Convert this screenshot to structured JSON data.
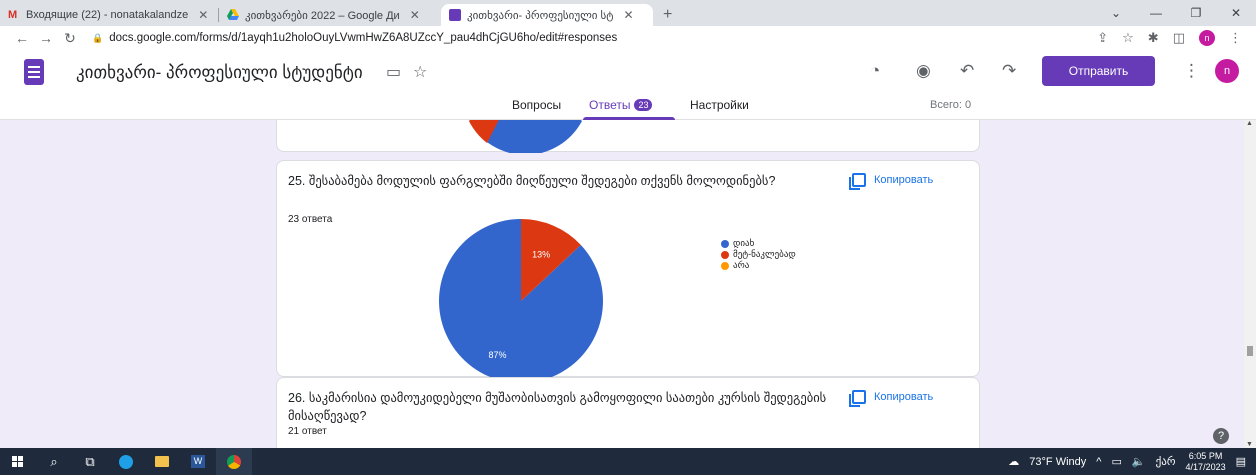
{
  "browser": {
    "tabs": [
      {
        "title": "Входящие (22) - nonatakalandze",
        "active": false
      },
      {
        "title": "კითხვარები 2022 – Google Ди",
        "active": false
      },
      {
        "title": "კითხვარი- პროფესიული სტ",
        "active": true
      }
    ],
    "url": "docs.google.com/forms/d/1ayqh1u2holoOuyLVwmHwZ6A8UZccY_pau4dhCjGU6ho/edit#responses",
    "profile_initial": "n"
  },
  "header": {
    "form_title": "კითხვარი- პროფესიული სტუდენტი",
    "send_label": "Отправить",
    "avatar_initial": "n",
    "tabs": {
      "questions": "Вопросы",
      "answers": "Ответы",
      "answers_count": "23",
      "settings": "Настройки"
    },
    "total_label": "Всего: 0"
  },
  "questions": [
    {
      "title": "25. შესაბამება მოდულის ფარგლებში მიღწეული შედეგები თქვენს მოლოდინებს?",
      "response_count": "23 ответа",
      "copy_label": "Копировать"
    },
    {
      "title": "26. საკმარისია დამოუკიდებელი მუშაობისათვის გამოყოფილი საათები კურსის შედეგების მისაღწევად?",
      "response_count": "21 ответ",
      "copy_label": "Копировать"
    }
  ],
  "chart_data": {
    "type": "pie",
    "categories": [
      "დიახ",
      "მეტ-ნაკლებად",
      "არა"
    ],
    "values": [
      87,
      13,
      0
    ],
    "labels": [
      "87%",
      "13%",
      ""
    ],
    "colors": [
      "#3366cc",
      "#dc3912",
      "#ff9900"
    ],
    "legend": "right"
  },
  "taskbar": {
    "weather": "73°F  Windy",
    "lang": "ქარ",
    "time": "6:05 PM",
    "date": "4/17/2023"
  }
}
